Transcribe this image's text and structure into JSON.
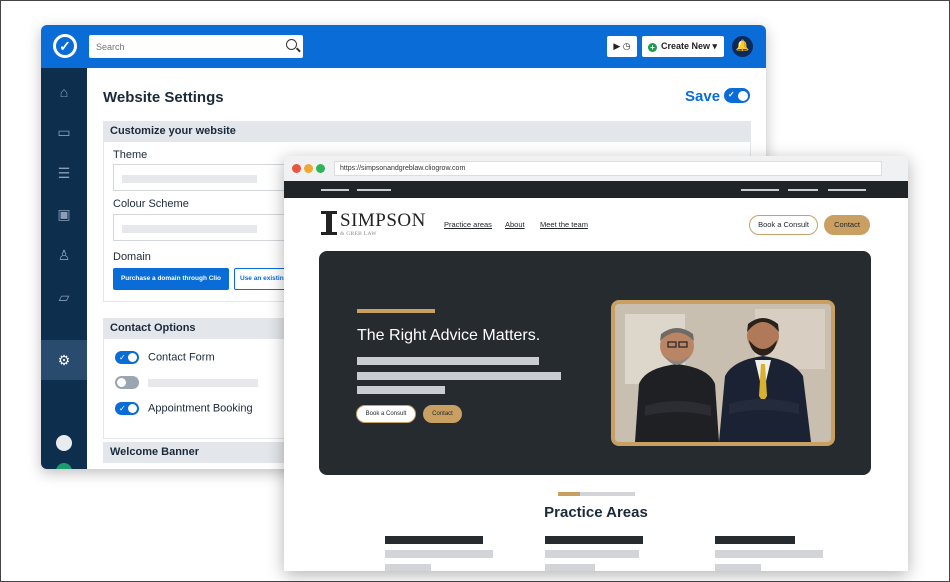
{
  "app": {
    "search_placeholder": "Search",
    "timer_label": "▶ ◷",
    "create_label": "Create New",
    "page_title": "Website Settings",
    "save_label": "Save",
    "sections": {
      "customize": "Customize your website",
      "contact": "Contact Options",
      "welcome": "Welcome Banner"
    },
    "fields": {
      "theme": "Theme",
      "colour_scheme": "Colour Scheme",
      "domain": "Domain"
    },
    "domain_buttons": {
      "purchase": "Purchase a domain through Clio",
      "existing": "Use an existin"
    },
    "contact_options": {
      "form": "Contact Form",
      "booking": "Appointment Booking"
    },
    "colors": {
      "brand_blue": "#0a6cd6",
      "sidebar": "#0e2e4e"
    }
  },
  "browser": {
    "url": "https://simpsonandgreblaw.cliogrow.com",
    "site": {
      "firm_name": "SIMPSON",
      "firm_sub": "& GREB LAW",
      "nav_links": [
        "Practice areas",
        "About",
        "Meet the team"
      ],
      "book_label": "Book a Consult",
      "contact_label": "Contact",
      "hero_title": "The Right Advice Matters.",
      "hero_book_label": "Book a Consult",
      "hero_contact_label": "Contact",
      "section_title": "Practice Areas"
    },
    "colors": {
      "gold": "#c9a062",
      "dark": "#262b30"
    }
  }
}
